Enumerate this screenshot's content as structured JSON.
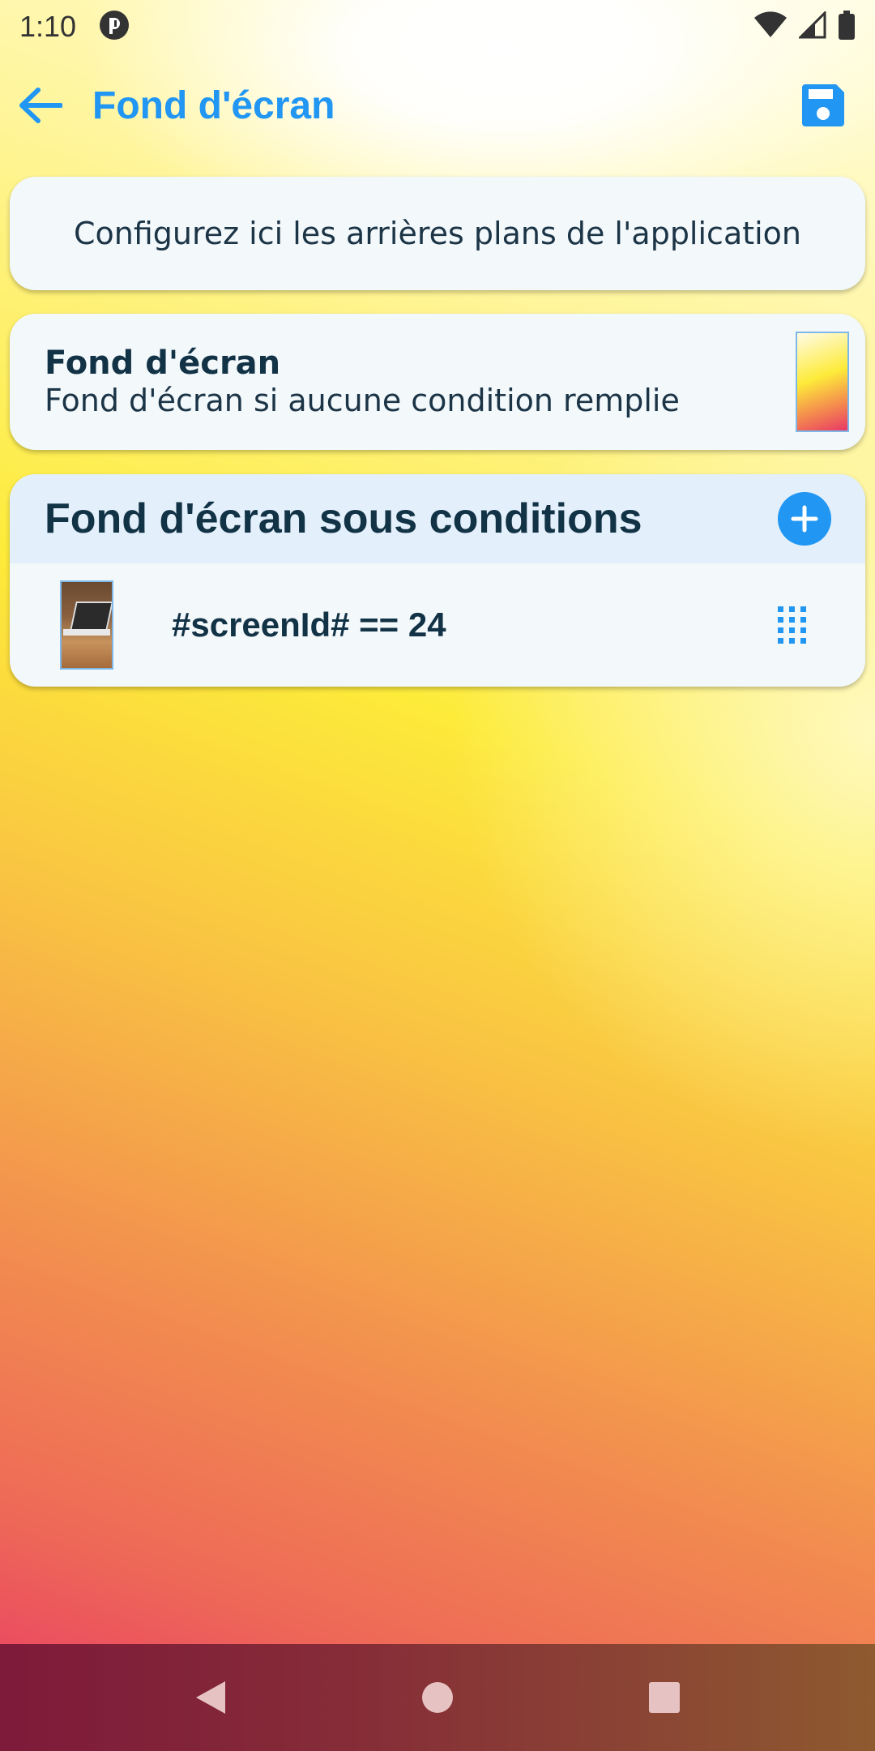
{
  "status_bar": {
    "time": "1:10"
  },
  "app_bar": {
    "title": "Fond d'écran"
  },
  "intro": {
    "text": "Configurez ici les arrières plans de l'application"
  },
  "default_wallpaper": {
    "title": "Fond d'écran",
    "subtitle": "Fond d'écran si aucune condition remplie"
  },
  "conditional": {
    "title": "Fond d'écran sous conditions",
    "items": [
      {
        "condition": "#screenId# == 24"
      }
    ]
  },
  "colors": {
    "accent": "#2196F3",
    "text_dark": "#123246",
    "card_bg": "#f3f8fb",
    "header_bg": "#e3f0fb"
  },
  "icons": {
    "back": "arrow-left",
    "save": "floppy-disk",
    "add": "plus-circle",
    "drag": "drag-handle-grid",
    "nav": [
      "triangle-back",
      "circle-home",
      "square-recents"
    ]
  }
}
